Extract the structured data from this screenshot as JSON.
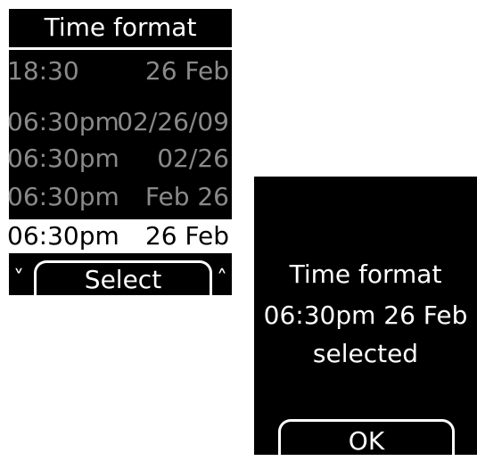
{
  "left_screen": {
    "title": "Time format",
    "options": [
      {
        "time": "18:30",
        "date": "26 Feb"
      },
      {
        "time": "06:30pm",
        "date": "02/26/09"
      },
      {
        "time": "06:30pm",
        "date": "02/26"
      },
      {
        "time": "06:30pm",
        "date": "Feb 26"
      },
      {
        "time": "06:30pm",
        "date": "26 Feb"
      }
    ],
    "selected_index": 4,
    "softkey": {
      "left_arrow": "˅",
      "label": "Select",
      "right_arrow": "˄"
    }
  },
  "right_screen": {
    "line1": "Time format",
    "line2": "06:30pm 26 Feb",
    "line3": "selected",
    "ok_label": "OK"
  },
  "colors": {
    "screen_bg": "#000000",
    "text_active": "#ffffff",
    "text_inactive": "#8a8a8a"
  }
}
